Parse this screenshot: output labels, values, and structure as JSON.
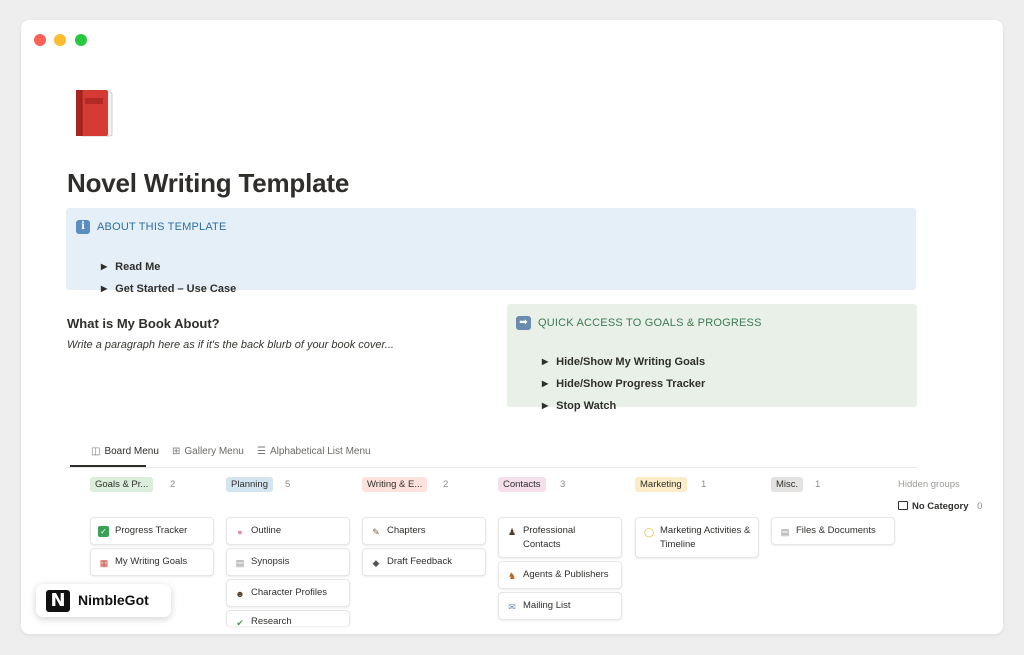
{
  "page": {
    "title": "Novel Writing Template",
    "icon": "red-book-icon"
  },
  "callout_about": {
    "heading": "ABOUT THIS TEMPLATE",
    "icon": "info-icon",
    "toggles": [
      "Read Me",
      "Get Started – Use Case"
    ]
  },
  "about": {
    "heading": "What is My Book About?",
    "paragraph": "Write a paragraph here as if it's the back blurb of your book cover..."
  },
  "callout_goals": {
    "heading": "QUICK ACCESS TO GOALS & PROGRESS",
    "icon": "right-arrow-icon",
    "toggles": [
      "Hide/Show My Writing Goals",
      "Hide/Show Progress Tracker",
      "Stop Watch"
    ]
  },
  "view_tabs": [
    {
      "label": "Board Menu",
      "icon": "board-icon",
      "active": true
    },
    {
      "label": "Gallery Menu",
      "icon": "gallery-icon",
      "active": false
    },
    {
      "label": "Alphabetical List Menu",
      "icon": "list-icon",
      "active": false
    }
  ],
  "board": {
    "groups": [
      {
        "label": "Goals & Pr...",
        "count": "2",
        "color": "#dbeddb",
        "cards": [
          {
            "title": "Progress Tracker",
            "icon": "check-mark-icon"
          },
          {
            "title": "My Writing Goals",
            "icon": "calendar-icon"
          }
        ]
      },
      {
        "label": "Planning",
        "count": "5",
        "color": "#d3e5ef",
        "cards": [
          {
            "title": "Outline",
            "icon": "brain-icon"
          },
          {
            "title": "Synopsis",
            "icon": "document-icon"
          },
          {
            "title": "Character Profiles",
            "icon": "person-icon"
          },
          {
            "title": "Research",
            "icon": "microscope-icon"
          }
        ]
      },
      {
        "label": "Writing & E...",
        "count": "2",
        "color": "#ffe2dd",
        "cards": [
          {
            "title": "Chapters",
            "icon": "pen-icon"
          },
          {
            "title": "Draft Feedback",
            "icon": "speech-icon"
          }
        ]
      },
      {
        "label": "Contacts",
        "count": "3",
        "color": "#f4dfeb",
        "cards": [
          {
            "title": "Professional Contacts",
            "icon": "person-suit-icon"
          },
          {
            "title": "Agents & Publishers",
            "icon": "people-icon"
          },
          {
            "title": "Mailing List",
            "icon": "mail-icon"
          }
        ]
      },
      {
        "label": "Marketing",
        "count": "1",
        "color": "#fdecc8",
        "cards": [
          {
            "title": "Marketing Activities & Timeline",
            "icon": "lightbulb-icon"
          }
        ]
      },
      {
        "label": "Misc.",
        "count": "1",
        "color": "#e3e2e0",
        "cards": [
          {
            "title": "Files & Documents",
            "icon": "file-icon"
          }
        ]
      }
    ],
    "hidden_groups_label": "Hidden groups",
    "no_category_label": "No Category",
    "no_category_count": "0"
  },
  "badge": {
    "logo_letter": "N",
    "text": "NimbleGot"
  }
}
